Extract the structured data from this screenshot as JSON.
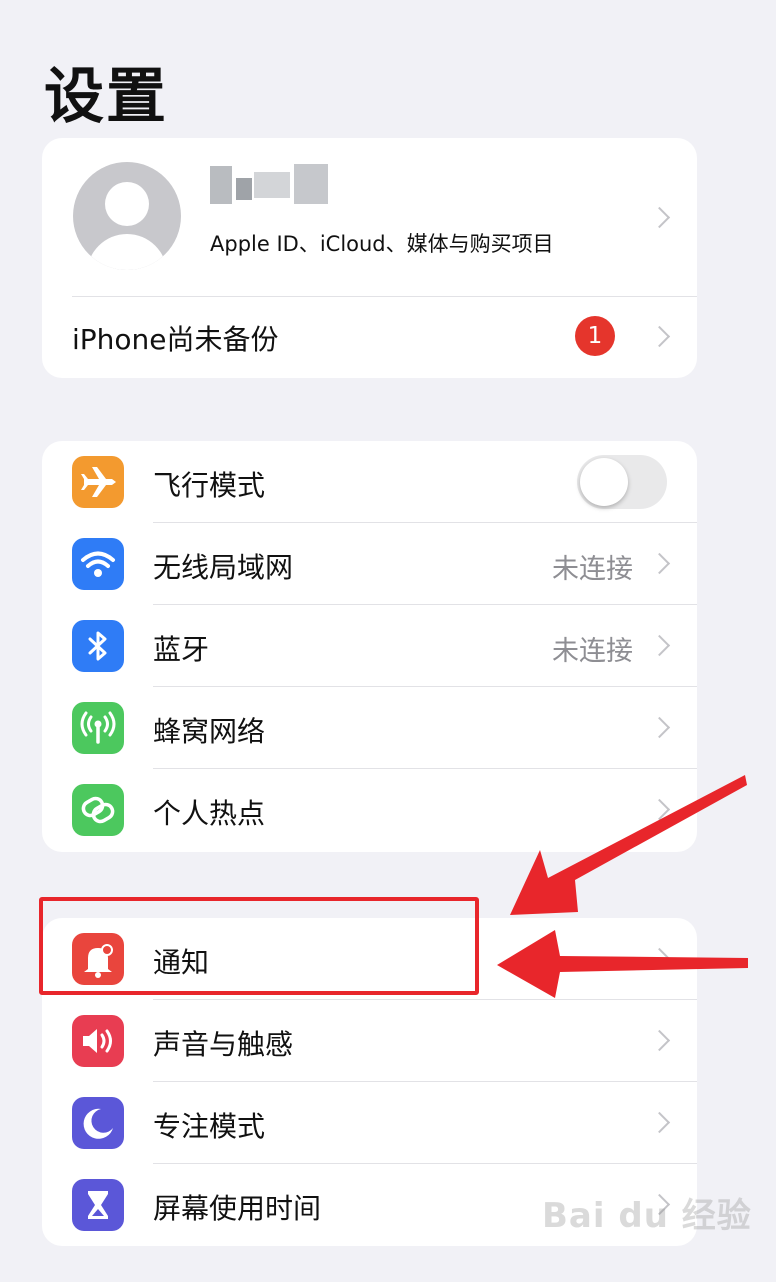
{
  "page": {
    "title": "设置"
  },
  "profile": {
    "subtitle": "Apple ID、iCloud、媒体与购买项目"
  },
  "backup": {
    "label": "iPhone尚未备份",
    "badge_count": "1"
  },
  "connectivity": [
    {
      "label": "飞行模式",
      "icon": "airplane-icon",
      "color": "#f39a2f",
      "toggle": false
    },
    {
      "label": "无线局域网",
      "icon": "wifi-icon",
      "color": "#2f7cf6",
      "value": "未连接"
    },
    {
      "label": "蓝牙",
      "icon": "bluetooth-icon",
      "color": "#2f7cf6",
      "value": "未连接"
    },
    {
      "label": "蜂窝网络",
      "icon": "antenna-icon",
      "color": "#4cc85e"
    },
    {
      "label": "个人热点",
      "icon": "link-icon",
      "color": "#4cc85e"
    }
  ],
  "system": [
    {
      "label": "通知",
      "icon": "bell-icon",
      "color": "#e9453d"
    },
    {
      "label": "声音与触感",
      "icon": "speaker-icon",
      "color": "#e83d52"
    },
    {
      "label": "专注模式",
      "icon": "moon-icon",
      "color": "#5b57d8"
    },
    {
      "label": "屏幕使用时间",
      "icon": "hourglass-icon",
      "color": "#5b57d8"
    }
  ],
  "annotation": {
    "color": "#e8262b"
  },
  "watermark": {
    "text": "Bai du 经验"
  }
}
